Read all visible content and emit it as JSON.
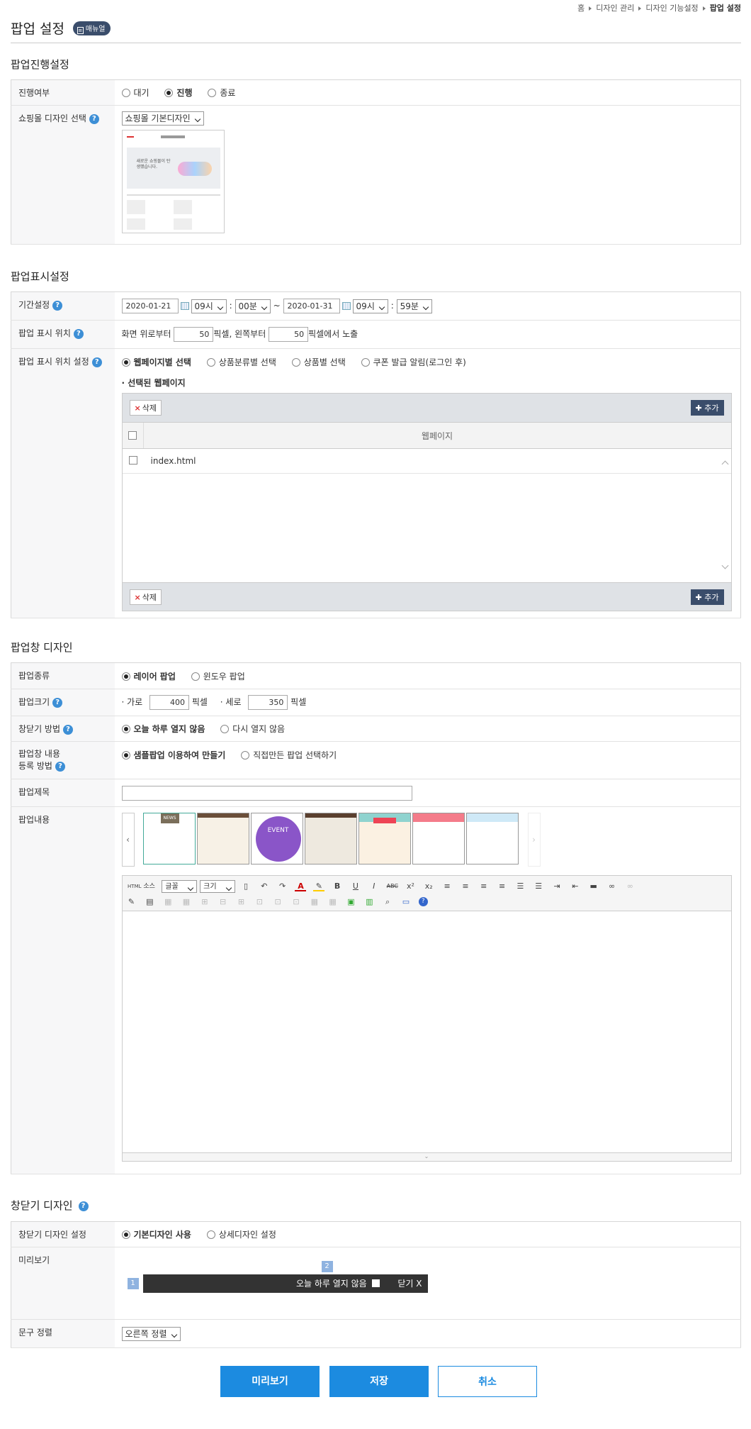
{
  "breadcrumb": [
    "홈",
    "디자인 관리",
    "디자인 기능설정",
    "팝업 설정"
  ],
  "page": {
    "title": "팝업 설정",
    "manual_label": "매뉴얼"
  },
  "sections": {
    "progress": "팝업진행설정",
    "display": "팝업표시설정",
    "design": "팝업창 디자인",
    "close": "창닫기 디자인"
  },
  "progress": {
    "status_label": "진행여부",
    "status_options": [
      "대기",
      "진행",
      "종료"
    ],
    "status_selected": 1,
    "mall_design_label": "쇼핑몰 디자인 선택",
    "mall_design_value": "쇼핑몰 기본디자인",
    "thumb_text": "새로운 쇼핑몰이 탄생했습니다."
  },
  "display": {
    "period_label": "기간설정",
    "start_date": "2020-01-21",
    "start_hour": "09시",
    "start_min": "00분",
    "tilde": "~",
    "end_date": "2020-01-31",
    "end_hour": "09시",
    "end_min": "59분",
    "colon": ":",
    "position_label": "팝업 표시 위치",
    "pos_prefix": "화면 위로부터",
    "top_px": "50",
    "pos_mid": "픽셀, 왼쪽부터",
    "left_px": "50",
    "pos_suffix": "픽셀에서 노출",
    "pos_setting_label": "팝업 표시 위치 설정",
    "pos_options": [
      "웹페이지별 선택",
      "상품분류별 선택",
      "상품별 선택",
      "쿠폰 발급 알림(로그인 후)"
    ],
    "selected_pages_label": "· 선택된 웹페이지",
    "delete_label": "삭제",
    "add_label": "추가",
    "grid_header": "웹페이지",
    "pages": [
      "index.html"
    ]
  },
  "design": {
    "type_label": "팝업종류",
    "type_options": [
      "레이어 팝업",
      "윈도우 팝업"
    ],
    "size_label": "팝업크기",
    "width_label": "· 가로",
    "width_value": "400",
    "px_label": "픽셀",
    "height_label": "· 세로",
    "height_value": "350",
    "close_method_label": "창닫기 방법",
    "close_options": [
      "오늘 하루 열지 않음",
      "다시 열지 않음"
    ],
    "content_method_label_1": "팝업창 내용",
    "content_method_label_2": "등록 방법",
    "content_options": [
      "샘플팝업 이용하여 만들기",
      "직접만든 팝업 선택하기"
    ],
    "title_label": "팝업제목",
    "content_label": "팝업내용",
    "tpl_texts": [
      "NEWS",
      "EVENT"
    ],
    "toolbar": {
      "source": "소스",
      "font": "글꼴",
      "size": "크기"
    }
  },
  "close_design": {
    "setting_label": "창닫기 디자인 설정",
    "setting_options": [
      "기본디자인 사용",
      "상세디자인 설정"
    ],
    "preview_label": "미리보기",
    "preview_today": "오늘 하루 열지 않음",
    "preview_close": "닫기 X",
    "marker_1": "1",
    "marker_2": "2",
    "align_label": "문구 정렬",
    "align_value": "오른쪽 정렬"
  },
  "buttons": {
    "preview": "미리보기",
    "save": "저장",
    "cancel": "취소"
  },
  "colors": {
    "accent": "#1c8be0",
    "dark": "#3a4d6b",
    "help": "#3d8fd6"
  }
}
